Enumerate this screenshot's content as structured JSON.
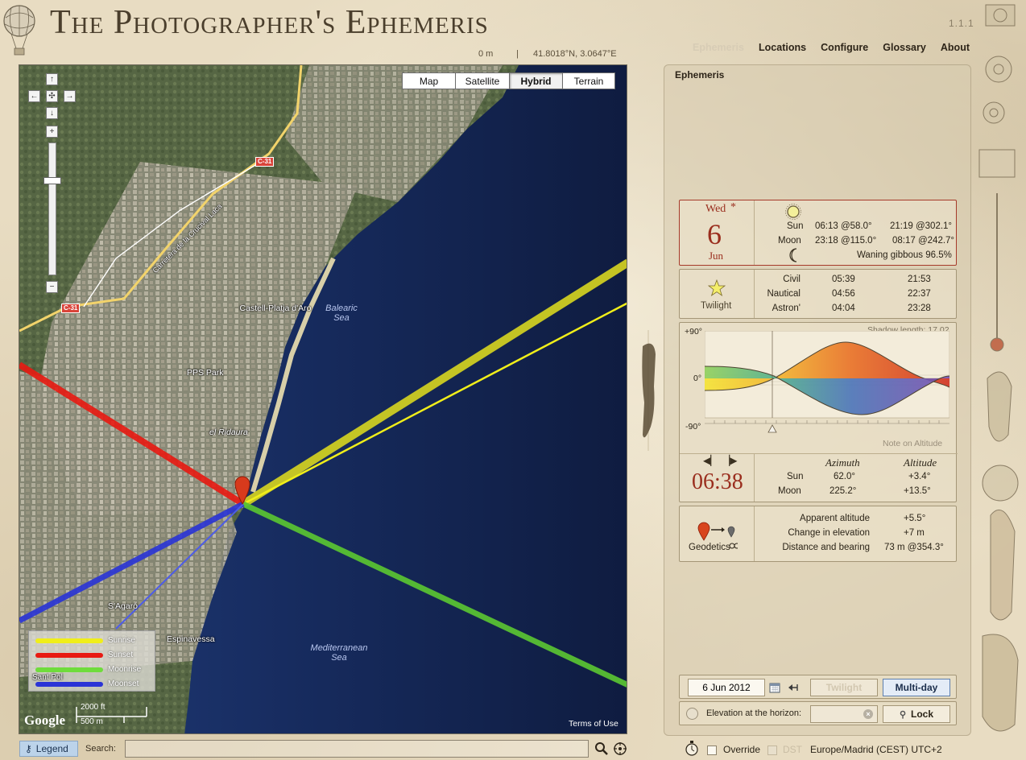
{
  "header": {
    "title": "The Photographer's Ephemeris",
    "version": "1.1.1",
    "elevation": "0 m",
    "separator": "|",
    "coordinates": "41.8018°N, 3.0647°E"
  },
  "nav": [
    {
      "label": "Ephemeris",
      "disabled": true
    },
    {
      "label": "Locations"
    },
    {
      "label": "Configure"
    },
    {
      "label": "Glossary"
    },
    {
      "label": "About"
    }
  ],
  "map": {
    "types": [
      {
        "label": "Map"
      },
      {
        "label": "Satellite"
      },
      {
        "label": "Hybrid",
        "active": true
      },
      {
        "label": "Terrain"
      }
    ],
    "zoom_level_fraction": 0.28,
    "labels": {
      "castell": "Castell-Platja d'Aro",
      "balearic": "Balearic Sea",
      "pps": "PPS Park",
      "ridaura": "el Ridaura",
      "sagaro": "S'Agaró",
      "espinavessa": "Espinavessa",
      "santpol": "Sant Pol",
      "mediterranean": "Mediterranean Sea",
      "road1": "C-31",
      "road2": "C-31",
      "road_name": "Carretera de la Crucival Laca"
    },
    "legend": [
      {
        "label": "Sunrise",
        "color": "#f0ee1a"
      },
      {
        "label": "Sunset",
        "color": "#e81a12"
      },
      {
        "label": "Moonrise",
        "color": "#6fdc3c"
      },
      {
        "label": "Moonset",
        "color": "#2a34d6"
      }
    ],
    "scale_ft": "2000 ft",
    "scale_m": "500 m",
    "google": "Google",
    "terms": "Terms of Use"
  },
  "bottom": {
    "legend_button": "Legend",
    "search_label": "Search:",
    "search_value": "",
    "search_placeholder": ""
  },
  "panel": {
    "title": "Ephemeris",
    "day": {
      "weekday": "Wed",
      "asterisk": "*",
      "date": "6",
      "month": "Jun",
      "sun_label": "Sun",
      "sun_rise": "06:13 @58.0°",
      "sun_set": "21:19 @302.1°",
      "moon_label": "Moon",
      "moon_rise": "23:18 @115.0°",
      "moon_set": "08:17 @242.7°",
      "moon_phase": "Waning gibbous 96.5%"
    },
    "twilight": {
      "label": "Twilight",
      "rows": [
        {
          "name": "Civil",
          "dawn": "05:39",
          "dusk": "21:53"
        },
        {
          "name": "Nautical",
          "dawn": "04:56",
          "dusk": "22:37"
        },
        {
          "name": "Astron'",
          "dawn": "04:04",
          "dusk": "23:28"
        }
      ]
    },
    "graph": {
      "y_top": "+90°",
      "y_mid": "0°",
      "y_bot": "-90°",
      "shadow": "Shadow length: 17.02",
      "note": "Note on Altitude",
      "time_fraction": 0.27
    },
    "position": {
      "time": "06:38",
      "azimuth_header": "Azimuth",
      "altitude_header": "Altitude",
      "sun_label": "Sun",
      "sun_az": "62.0°",
      "sun_alt": "+3.4°",
      "moon_label": "Moon",
      "moon_az": "225.2°",
      "moon_alt": "+13.5°"
    },
    "geodetics": {
      "label": "Geodetics",
      "rows": [
        {
          "name": "Apparent altitude",
          "value": "+5.5°"
        },
        {
          "name": "Change in elevation",
          "value": "+7 m"
        },
        {
          "name": "Distance and bearing",
          "value": "73 m @354.3°"
        }
      ]
    },
    "controls": {
      "date_value": "6 Jun 2012",
      "twilight_button": "Twilight",
      "multiday_button": "Multi-day",
      "elevation_label": "Elevation at the horizon:",
      "elevation_value": "",
      "lock_button": "Lock",
      "override_label": "Override",
      "dst_label": "DST",
      "timezone": "Europe/Madrid (CEST) UTC+2"
    }
  }
}
